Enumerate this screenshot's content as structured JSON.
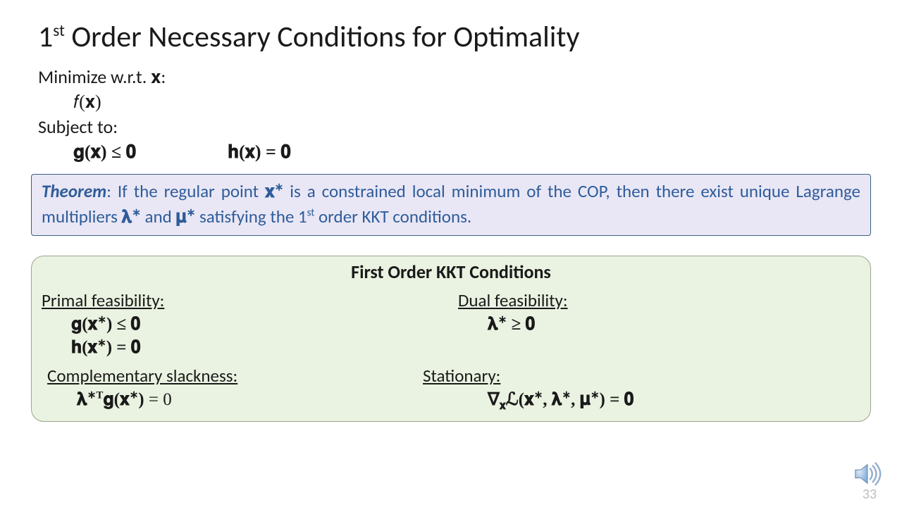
{
  "title_html": "1<sup>st</sup> Order Necessary Conditions for Optimality",
  "problem": {
    "minimize_label": "Minimize w.r.t. 𝐱:",
    "objective": "𝑓(𝐱)",
    "subject_label": "Subject to:",
    "ineq": "𝐠(𝐱) ≤ 𝟎",
    "eq": "𝐡(𝐱) = 𝟎"
  },
  "theorem": {
    "prefix": "Theorem",
    "t1": ": If the regular point ",
    "xs": "𝐱",
    "t2": " is a constrained local minimum of the COP, then there exist unique Lagrange multipliers ",
    "lam": "𝛌",
    "t3": " and ",
    "mu": "𝛍",
    "t4": " satisfying the 1",
    "st": "st",
    "t5": " order KKT conditions."
  },
  "kkt": {
    "heading": "First Order KKT Conditions",
    "primal_label": "Primal feasibility:",
    "primal_g": "𝐠(𝐱*) ≤ 𝟎",
    "primal_h": "𝐡(𝐱*) = 𝟎",
    "dual_label": "Dual feasibility:",
    "dual": "𝛌* ≥ 𝟎",
    "comp_label": "Complementary slackness:",
    "comp": "𝛌*ᵀ𝐠(𝐱*) = 0",
    "stat_label": "Stationary:",
    "stat": "∇𝐱 ℒ(𝐱*, 𝛌*, 𝛍*) = 𝟎"
  },
  "page": "33"
}
